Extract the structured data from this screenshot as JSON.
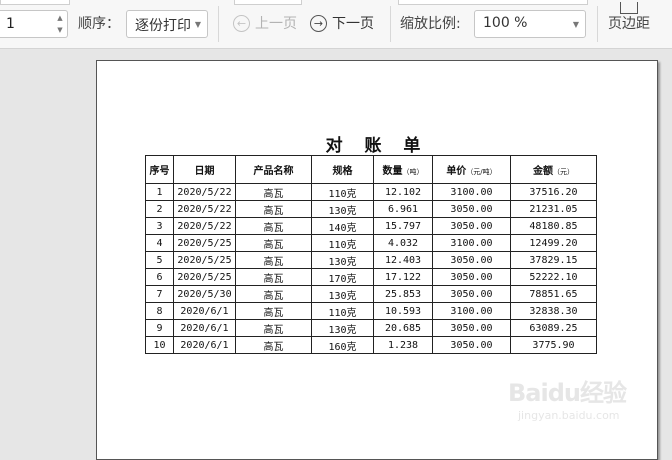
{
  "toolbar": {
    "copies": {
      "value": "1"
    },
    "order": {
      "label": "顺序：",
      "value": "逐份打印"
    },
    "prev_page": {
      "label": "上一页",
      "icon": "arrow-left-circle-icon"
    },
    "next_page": {
      "label": "下一页",
      "icon": "arrow-right-circle-icon"
    },
    "zoom": {
      "label": "缩放比例:",
      "value": "100 %"
    },
    "margins": {
      "label": "页边距",
      "icon": "page-margins-icon"
    }
  },
  "document": {
    "title": "对 账 单",
    "columns": [
      {
        "label": "序号",
        "unit": ""
      },
      {
        "label": "日期",
        "unit": ""
      },
      {
        "label": "产品名称",
        "unit": ""
      },
      {
        "label": "规格",
        "unit": ""
      },
      {
        "label": "数量",
        "unit": "（吨）"
      },
      {
        "label": "单价",
        "unit": "（元/吨）"
      },
      {
        "label": "金额",
        "unit": "（元）"
      }
    ],
    "rows": [
      [
        "1",
        "2020/5/22",
        "高瓦",
        "110克",
        "12.102",
        "3100.00",
        "37516.20"
      ],
      [
        "2",
        "2020/5/22",
        "高瓦",
        "130克",
        "6.961",
        "3050.00",
        "21231.05"
      ],
      [
        "3",
        "2020/5/22",
        "高瓦",
        "140克",
        "15.797",
        "3050.00",
        "48180.85"
      ],
      [
        "4",
        "2020/5/25",
        "高瓦",
        "110克",
        "4.032",
        "3100.00",
        "12499.20"
      ],
      [
        "5",
        "2020/5/25",
        "高瓦",
        "130克",
        "12.403",
        "3050.00",
        "37829.15"
      ],
      [
        "6",
        "2020/5/25",
        "高瓦",
        "170克",
        "17.122",
        "3050.00",
        "52222.10"
      ],
      [
        "7",
        "2020/5/30",
        "高瓦",
        "130克",
        "25.853",
        "3050.00",
        "78851.65"
      ],
      [
        "8",
        "2020/6/1",
        "高瓦",
        "110克",
        "10.593",
        "3100.00",
        "32838.30"
      ],
      [
        "9",
        "2020/6/1",
        "高瓦",
        "130克",
        "20.685",
        "3050.00",
        "63089.25"
      ],
      [
        "10",
        "2020/6/1",
        "高瓦",
        "160克",
        "1.238",
        "3050.00",
        "3775.90"
      ]
    ]
  },
  "watermark": {
    "text": "Baidu经验",
    "sub": "jingyan.baidu.com"
  }
}
